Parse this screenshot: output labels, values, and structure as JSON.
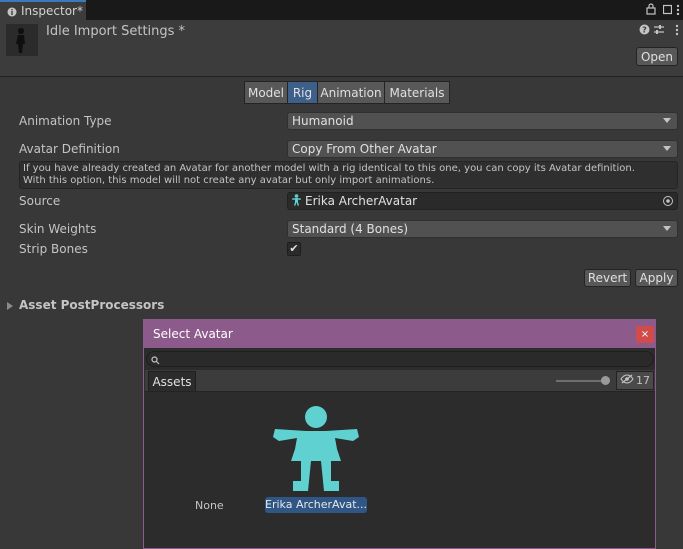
{
  "window": {
    "tab_title": "Inspector*",
    "tab_icons": [
      "info-icon",
      "lock-icon",
      "maximize-icon",
      "more-icon"
    ]
  },
  "header": {
    "title": "Idle Import Settings *",
    "open_label": "Open",
    "icons": [
      "help-icon",
      "preset-icon",
      "more-icon"
    ]
  },
  "tabs": [
    {
      "label": "Model",
      "active": false
    },
    {
      "label": "Rig",
      "active": true
    },
    {
      "label": "Animation",
      "active": false
    },
    {
      "label": "Materials",
      "active": false
    }
  ],
  "fields": {
    "animation_type_label": "Animation Type",
    "animation_type_value": "Humanoid",
    "avatar_definition_label": "Avatar Definition",
    "avatar_definition_value": "Copy From Other Avatar",
    "help_line1": "If you have already created an Avatar for another model with a rig identical to this one, you can copy its Avatar definition.",
    "help_line2": "With this option, this model will not create any avatar but only import animations.",
    "source_label": "Source",
    "source_value": "Erika ArcherAvatar",
    "skin_weights_label": "Skin Weights",
    "skin_weights_value": "Standard (4 Bones)",
    "strip_bones_label": "Strip Bones",
    "strip_bones_checked": true,
    "check_mark": "✔"
  },
  "actions": {
    "revert_label": "Revert",
    "apply_label": "Apply"
  },
  "foldout": {
    "label": "Asset PostProcessors"
  },
  "popup": {
    "title": "Select Avatar",
    "close_glyph": "×",
    "search_placeholder": "",
    "assets_tab": "Assets",
    "hidden_count": "17",
    "items": [
      {
        "label": "None",
        "selected": false
      },
      {
        "label": "Erika ArcherAvat...",
        "selected": true
      }
    ],
    "colors": {
      "title_bar": "#8c5b8c",
      "close": "#d24b4b",
      "avatar_icon": "#5fd1d1",
      "selection": "#2f5685"
    }
  }
}
